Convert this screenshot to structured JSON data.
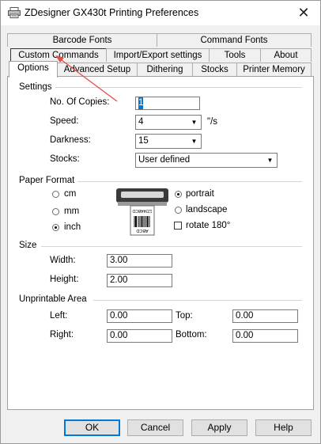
{
  "window": {
    "title": "ZDesigner GX430t Printing Preferences",
    "close_glyph": "✕"
  },
  "tabs": {
    "row1": [
      "Barcode Fonts",
      "Command Fonts"
    ],
    "row2": [
      "Custom Commands",
      "Import/Export settings",
      "Tools",
      "About"
    ],
    "row3": [
      "Options",
      "Advanced Setup",
      "Dithering",
      "Stocks",
      "Printer Memory"
    ],
    "active": "Options",
    "highlighted": "Custom Commands"
  },
  "settings": {
    "title": "Settings",
    "copies_label": "No. Of Copies:",
    "copies_value": "1",
    "speed_label": "Speed:",
    "speed_value": "4",
    "speed_unit": "\"/s",
    "darkness_label": "Darkness:",
    "darkness_value": "15",
    "stocks_label": "Stocks:",
    "stocks_value": "User defined"
  },
  "paper_format": {
    "title": "Paper Format",
    "unit_options": [
      "cm",
      "mm",
      "inch"
    ],
    "unit_selected": "inch",
    "orientation_options": [
      "portrait",
      "landscape"
    ],
    "orientation_selected": "portrait",
    "rotate_label": "rotate 180°",
    "rotate_checked": false,
    "label_art_text": [
      "ABCD",
      "1234ABCD"
    ]
  },
  "size": {
    "title": "Size",
    "width_label": "Width:",
    "width_value": "3.00",
    "height_label": "Height:",
    "height_value": "2.00"
  },
  "unprintable": {
    "title": "Unprintable Area",
    "left_label": "Left:",
    "left_value": "0.00",
    "top_label": "Top:",
    "top_value": "0.00",
    "right_label": "Right:",
    "right_value": "0.00",
    "bottom_label": "Bottom:",
    "bottom_value": "0.00"
  },
  "buttons": {
    "ok": "OK",
    "cancel": "Cancel",
    "apply": "Apply",
    "help": "Help"
  },
  "colors": {
    "annotation_arrow": "#e0504e",
    "focus": "#0078d7"
  }
}
